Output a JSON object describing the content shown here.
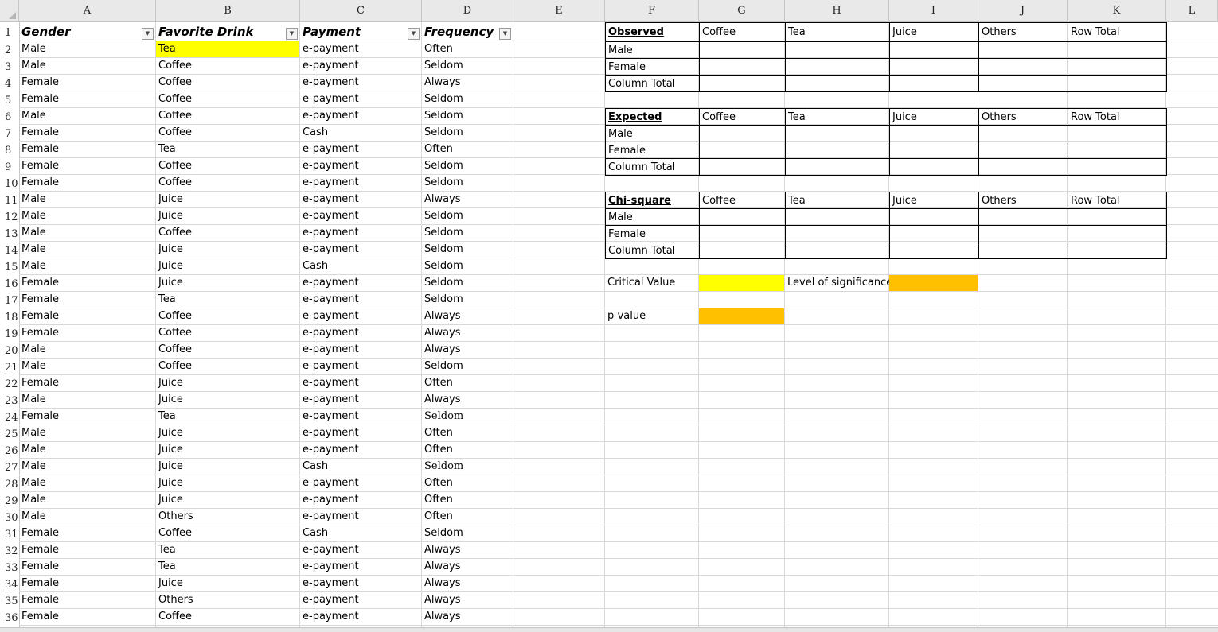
{
  "columns": [
    "A",
    "B",
    "C",
    "D",
    "E",
    "F",
    "G",
    "H",
    "I",
    "J",
    "K",
    "L"
  ],
  "row_numbers": [
    "1",
    "2",
    "3",
    "4",
    "5",
    "6",
    "7",
    "8",
    "9",
    "10",
    "11",
    "12",
    "13",
    "14",
    "15",
    "16",
    "17",
    "18",
    "19",
    "20",
    "21",
    "22",
    "23",
    "24",
    "25",
    "26",
    "27",
    "28",
    "29",
    "30",
    "31",
    "32",
    "33",
    "34",
    "35",
    "36"
  ],
  "headers": [
    "Gender",
    "Favorite Drink",
    "Payment",
    "Frequency"
  ],
  "filter_icon": "dropdown-arrow",
  "rows": [
    [
      "Male",
      "Tea",
      "e-payment",
      "Often"
    ],
    [
      "Male",
      "Coffee",
      "e-payment",
      "Seldom"
    ],
    [
      "Female",
      "Coffee",
      "e-payment",
      "Always"
    ],
    [
      "Female",
      "Coffee",
      "e-payment",
      "Seldom"
    ],
    [
      "Male",
      "Coffee",
      "e-payment",
      "Seldom"
    ],
    [
      "Female",
      "Coffee",
      "Cash",
      "Seldom"
    ],
    [
      "Female",
      "Tea",
      "e-payment",
      "Often"
    ],
    [
      "Female",
      "Coffee",
      "e-payment",
      "Seldom"
    ],
    [
      "Female",
      "Coffee",
      "e-payment",
      "Seldom"
    ],
    [
      "Male",
      "Juice",
      "e-payment",
      "Always"
    ],
    [
      "Male",
      "Juice",
      "e-payment",
      "Seldom"
    ],
    [
      "Male",
      "Coffee",
      "e-payment",
      "Seldom"
    ],
    [
      "Male",
      "Juice",
      "e-payment",
      "Seldom"
    ],
    [
      "Male",
      "Juice",
      "Cash",
      "Seldom"
    ],
    [
      "Female",
      "Juice",
      "e-payment",
      "Seldom"
    ],
    [
      "Female",
      "Tea",
      "e-payment",
      "Seldom"
    ],
    [
      "Female",
      "Coffee",
      "e-payment",
      "Always"
    ],
    [
      "Female",
      "Coffee",
      "e-payment",
      "Always"
    ],
    [
      "Male",
      "Coffee",
      "e-payment",
      "Always"
    ],
    [
      "Male",
      "Coffee",
      "e-payment",
      "Seldom"
    ],
    [
      "Female",
      "Juice",
      "e-payment",
      "Often"
    ],
    [
      "Male",
      "Juice",
      "e-payment",
      "Always"
    ],
    [
      "Female",
      "Tea",
      "e-payment",
      "Seldom"
    ],
    [
      "Male",
      "Juice",
      "e-payment",
      "Often"
    ],
    [
      "Male",
      "Juice",
      "e-payment",
      "Often"
    ],
    [
      "Male",
      "Juice",
      "Cash",
      "Seldom"
    ],
    [
      "Male",
      "Juice",
      "e-payment",
      "Often"
    ],
    [
      "Male",
      "Juice",
      "e-payment",
      "Often"
    ],
    [
      "Male",
      "Others",
      "e-payment",
      "Often"
    ],
    [
      "Female",
      "Coffee",
      "Cash",
      "Seldom"
    ],
    [
      "Female",
      "Tea",
      "e-payment",
      "Always"
    ],
    [
      "Female",
      "Tea",
      "e-payment",
      "Always"
    ],
    [
      "Female",
      "Juice",
      "e-payment",
      "Always"
    ],
    [
      "Female",
      "Others",
      "e-payment",
      "Always"
    ],
    [
      "Female",
      "Coffee",
      "e-payment",
      "Always"
    ]
  ],
  "tables": [
    {
      "title": "Observed",
      "cols": [
        "Coffee",
        "Tea",
        "Juice",
        "Others",
        "Row Total"
      ],
      "rows": [
        "Male",
        "Female",
        "Column Total"
      ]
    },
    {
      "title": "Expected",
      "cols": [
        "Coffee",
        "Tea",
        "Juice",
        "Others",
        "Row Total"
      ],
      "rows": [
        "Male",
        "Female",
        "Column Total"
      ]
    },
    {
      "title": "Chi-square",
      "cols": [
        "Coffee",
        "Tea",
        "Juice",
        "Others",
        "Row Total"
      ],
      "rows": [
        "Male",
        "Female",
        "Column Total"
      ]
    }
  ],
  "labels": {
    "critical_value": "Critical Value",
    "level_of_significance": "Level of significance",
    "p_value": "p-value"
  },
  "colors": {
    "highlight_yellow": "#ffff00",
    "highlight_orange": "#ffc000"
  }
}
